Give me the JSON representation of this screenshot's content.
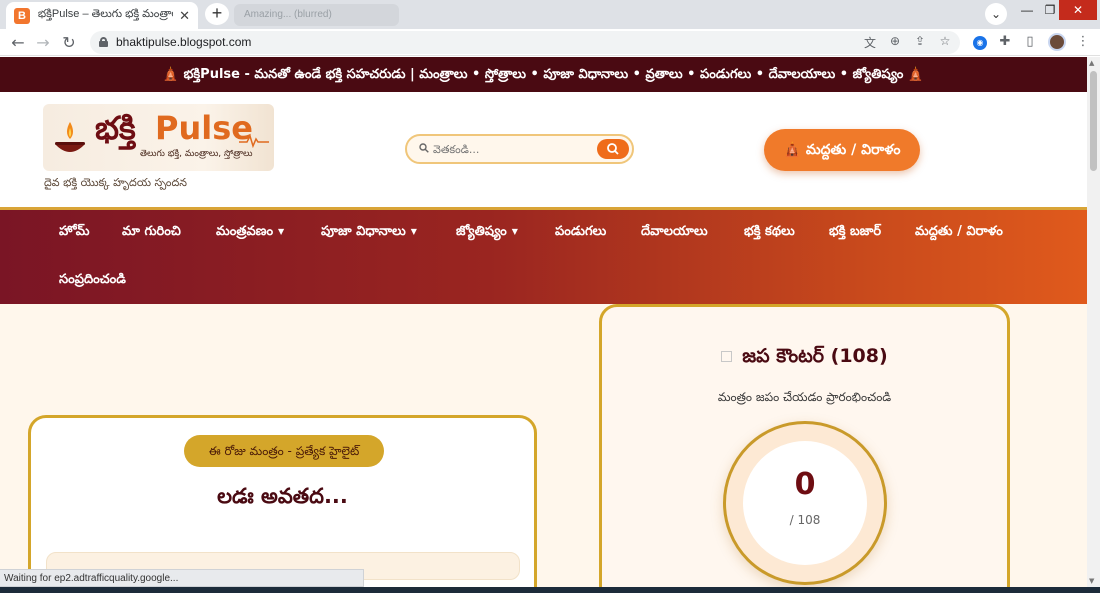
{
  "browser": {
    "tab_title": "భక్తిPulse – తెలుగు భక్తి మంత్రాలు, స్తో",
    "tab_favicon": "B",
    "tab_close": "✕",
    "new_tab": "+",
    "background_tab_ghost": "Amazing... (blurred)",
    "url": "bhaktipulse.blogspot.com",
    "icons": [
      "back-arrow-icon",
      "forward-arrow-icon",
      "reload-icon",
      "lock-icon",
      "translate-icon",
      "zoom-icon",
      "share-icon",
      "bookmark-star-icon",
      "extension-icon",
      "puzzle-icon",
      "sidebar-icon",
      "profile-avatar",
      "menu-icon"
    ]
  },
  "site": {
    "announcement": "🛕 భక్తిPulse - మనతో ఉండే భక్తి సహచరుడు | మంత్రాలు • స్తోత్రాలు • పూజా విధానాలు • వ్రతాలు • పండుగలు • దేవాలయాలు • జ్యోతిష్యం 🛕",
    "logo_bhakti": "భక్తి",
    "logo_pulse": "Pulse",
    "logo_tagline": "తెలుగు భక్తి, మంత్రాలు, స్తోత్రాలు",
    "description": "దైవ భక్తి యొక్క హృదయ స్పందన",
    "search_placeholder": "వెతకండి...",
    "donate_label": "🛕 మద్దతు / విరాళం"
  },
  "nav": {
    "home": "హోమ్",
    "about": "మా గురించి",
    "mantras": "మంత్రవణం",
    "puja": "పూజా విధానాలు",
    "astrology": "జ్యోతిష్యం",
    "festivals": "పండుగలు",
    "temples": "దేవాలయాలు",
    "stories": "భక్తి కథలు",
    "bazaar": "భక్తి బజార్",
    "support": "మద్దతు / విరాళం",
    "contact": "సంప్రదించండి",
    "caret": "▼"
  },
  "mantra_card": {
    "badge": "ఈ రోజు మంత్రం - ప్రత్యేక హైలైట్",
    "loading": "లడః అవతద..."
  },
  "counter_card": {
    "title": "జప కౌంటర్ (108)",
    "subtitle": "మంత్రం జపం చేయడం ప్రారంభించండి",
    "count": "0",
    "total": "/ 108"
  },
  "status": {
    "text": "Waiting for ep2.adtrafficquality.google..."
  },
  "colors": {
    "maroon": "#4a0a12",
    "orange": "#f07a2a",
    "gold": "#d4a62a",
    "cream": "#fff7ec"
  }
}
